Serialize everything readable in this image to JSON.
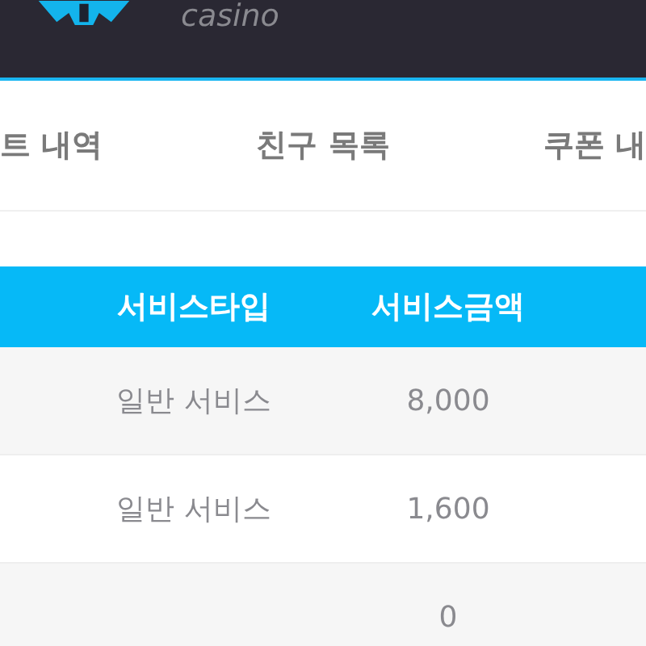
{
  "header": {
    "logo_text": "casino"
  },
  "tabs": [
    {
      "label": "트 내역",
      "selected": false
    },
    {
      "label": "친구 목록",
      "selected": false
    },
    {
      "label": "쿠폰 내",
      "selected": false
    }
  ],
  "table": {
    "columns": [
      "서비스타입",
      "서비스금액"
    ],
    "rows": [
      {
        "service_type": "일반 서비스",
        "amount": "8,000"
      },
      {
        "service_type": "일반 서비스",
        "amount": "1,600"
      },
      {
        "amount": "0"
      }
    ]
  }
}
